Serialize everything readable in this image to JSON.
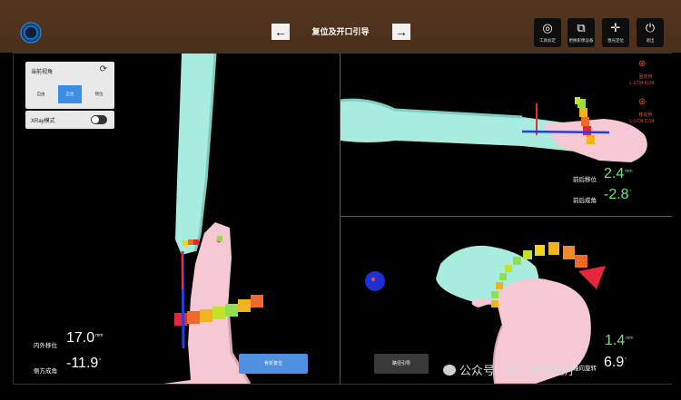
{
  "header": {
    "title": "复位及开口引导",
    "back_arrow": "←",
    "forward_arrow": "→",
    "tools": [
      {
        "icon": "target-icon",
        "glyph": "◎",
        "label": "工具标定"
      },
      {
        "icon": "image-swap-icon",
        "glyph": "⧉",
        "label": "更换影像设备"
      },
      {
        "icon": "crosshair-icon",
        "glyph": "✛",
        "label": "激光定位"
      },
      {
        "icon": "power-icon",
        "glyph": "⏻",
        "label": "退出"
      }
    ]
  },
  "left_panel": {
    "view_title": "当前视角",
    "view_options": [
      "自由",
      "正位",
      "侧位"
    ],
    "active_view": "正位",
    "xray_label": "XRay模式",
    "xray_on": false
  },
  "left_view": {
    "measure1_label": "内外移位",
    "measure1_value": "17.0",
    "measure1_unit": "mm",
    "measure2_label": "侧方成角",
    "measure2_value": "-11.9",
    "measure2_unit": "°",
    "button_label": "骨折复位"
  },
  "top_right_view": {
    "fixed_label": "固定骨",
    "fixed_coords": "L:1734 D:24",
    "moving_label": "移动骨",
    "moving_coords": "L:1734 D:24",
    "measure1_label": "前后移位",
    "measure1_value": "2.4",
    "measure1_unit": "mm",
    "measure2_label": "前后成角",
    "measure2_value": "-2.8",
    "measure2_unit": "°"
  },
  "bottom_right_view": {
    "measure1_value": "1.4",
    "measure1_unit": "mm",
    "measure2_label": "轴向旋转",
    "measure2_value": "6.9",
    "measure2_unit": "°",
    "button_label": "路径引导"
  },
  "watermark": "公众号 · 维卓致远医疗",
  "colors": {
    "bone": "#a8ecdf",
    "bone_pink": "#f5c8d4",
    "accent_blue": "#4f91e0",
    "green": "#6ee87a",
    "red": "#e0553a"
  }
}
